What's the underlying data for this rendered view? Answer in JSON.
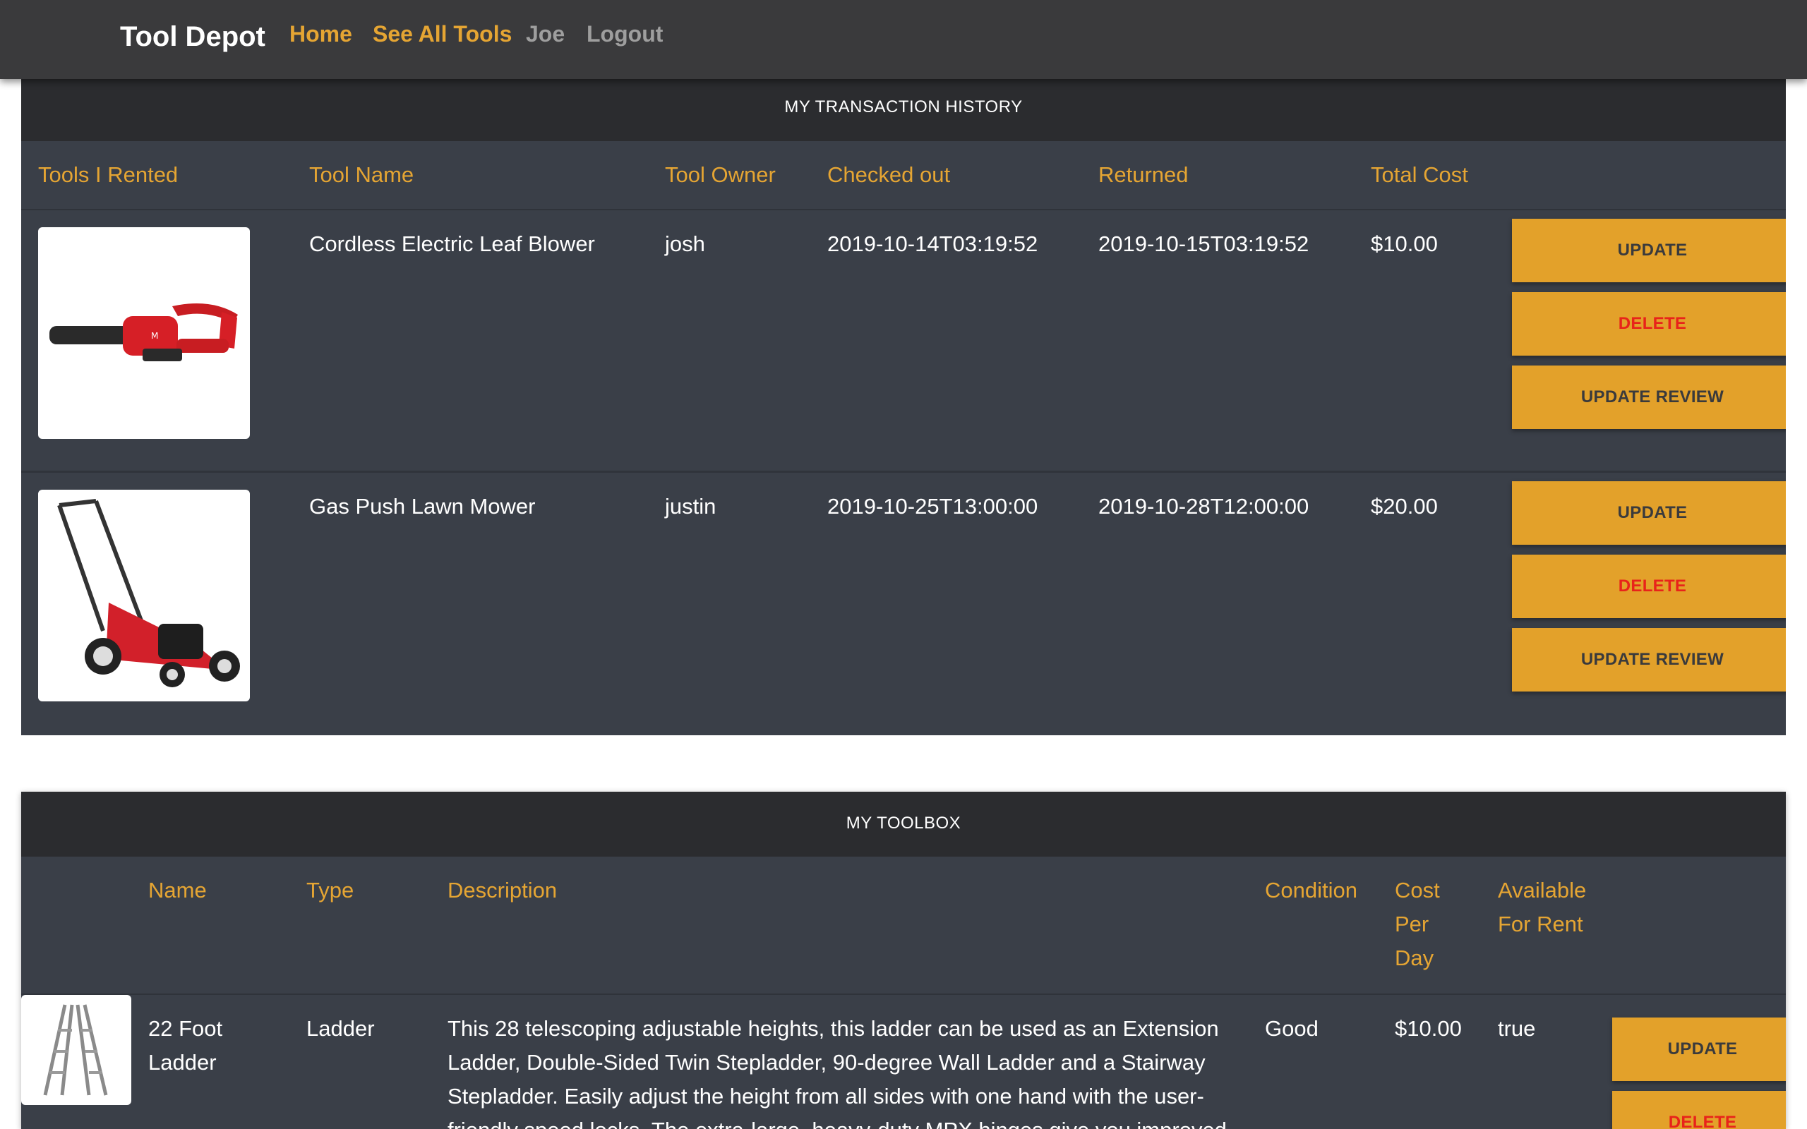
{
  "nav": {
    "brand": "Tool Depot",
    "links": [
      {
        "label": "Home"
      },
      {
        "label": "See All Tools"
      },
      {
        "label": "Joe"
      },
      {
        "label": "Logout"
      }
    ]
  },
  "transactions": {
    "title": "MY TRANSACTION HISTORY",
    "columns": [
      "Tools I Rented",
      "Tool Name",
      "Tool Owner",
      "Checked out",
      "Returned",
      "Total Cost"
    ],
    "rows": [
      {
        "image": "leaf-blower-image",
        "tool_name": "Cordless Electric Leaf Blower",
        "owner": "josh",
        "checked_out": "2019-10-14T03:19:52",
        "returned": "2019-10-15T03:19:52",
        "total_cost": "$10.00"
      },
      {
        "image": "lawn-mower-image",
        "tool_name": "Gas Push Lawn Mower",
        "owner": "justin",
        "checked_out": "2019-10-25T13:00:00",
        "returned": "2019-10-28T12:00:00",
        "total_cost": "$20.00"
      }
    ],
    "buttons": {
      "update": "UPDATE",
      "delete": "DELETE",
      "update_review": "UPDATE REVIEW"
    }
  },
  "toolbox": {
    "title": "MY TOOLBOX",
    "columns": {
      "name": "Name",
      "type": "Type",
      "description": "Description",
      "condition": "Condition",
      "cost_per_day": [
        "Cost",
        "Per",
        "Day"
      ],
      "available": [
        "Available",
        "For Rent"
      ]
    },
    "rows": [
      {
        "image": "ladder-image",
        "name": [
          "22 Foot",
          "Ladder"
        ],
        "type": "Ladder",
        "description": [
          "This 28 telescoping adjustable heights, this ladder can be used as an Extension",
          "Ladder, Double-Sided Twin Stepladder, 90-degree Wall Ladder and a Stairway",
          "Stepladder. Easily adjust the height from all sides with one hand with the user-",
          "friendly speed locks. The extra-large, heavy-duty MPX hinges give you improved"
        ],
        "condition": "Good",
        "cost_per_day": "$10.00",
        "available": "true"
      }
    ],
    "buttons": {
      "update": "UPDATE",
      "delete": "DELETE"
    }
  },
  "colors": {
    "accent": "#e5a533",
    "button": "#e3a12a",
    "delete_text": "#e8231a",
    "navbar": "#3a3a3c",
    "card": "#3a3f48"
  }
}
